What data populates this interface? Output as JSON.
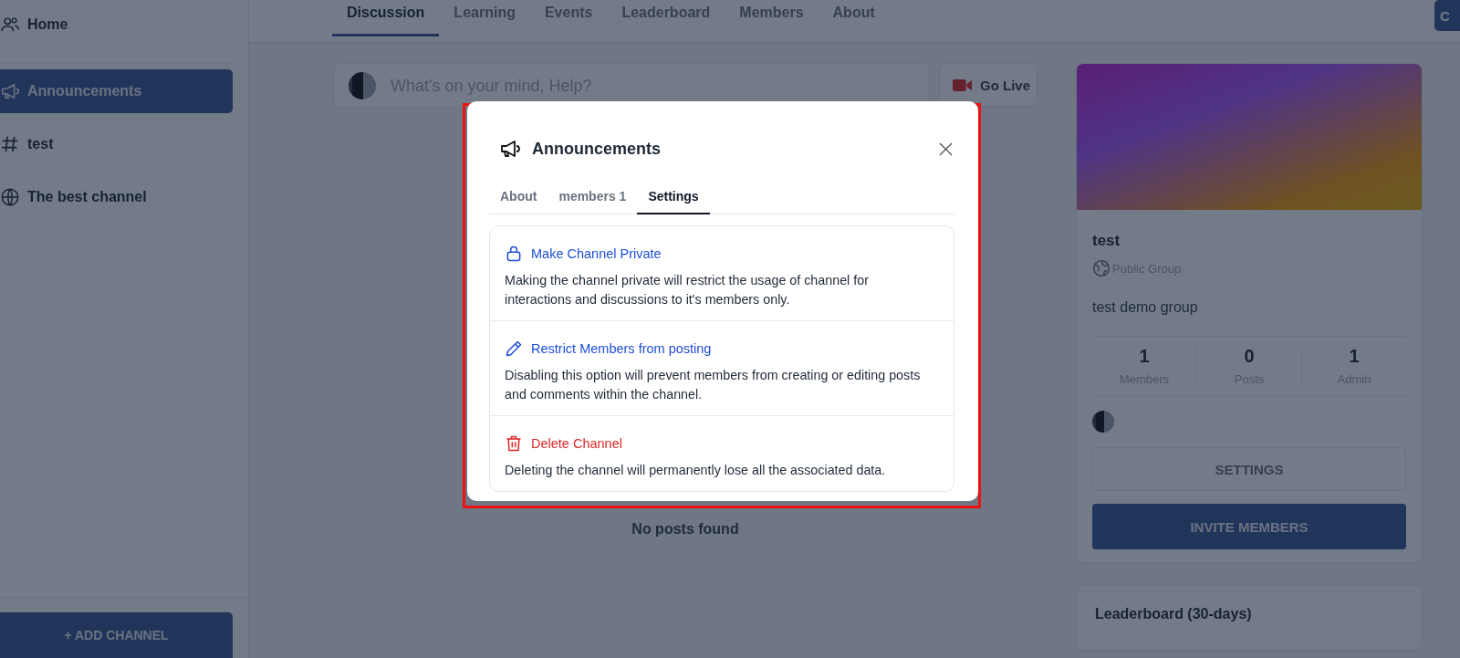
{
  "sidebar": {
    "home": {
      "label": "Home"
    },
    "channels": [
      {
        "label": "Announcements",
        "kind": "megaphone",
        "selected": true
      },
      {
        "label": "test",
        "kind": "hash",
        "selected": false
      },
      {
        "label": "The best channel",
        "kind": "globe",
        "selected": false
      }
    ],
    "add_button": "+ ADD CHANNEL"
  },
  "nav_tabs": [
    {
      "label": "Discussion",
      "selected": true
    },
    {
      "label": "Learning",
      "selected": false
    },
    {
      "label": "Events",
      "selected": false
    },
    {
      "label": "Leaderboard",
      "selected": false
    },
    {
      "label": "Members",
      "selected": false
    },
    {
      "label": "About",
      "selected": false
    }
  ],
  "header_button": "C",
  "composer": {
    "placeholder": "What's on your mind, Help?",
    "go_live": "Go Live"
  },
  "feed": {
    "empty_text": "No posts found"
  },
  "group_card": {
    "name": "test",
    "privacy": "Public Group",
    "description": "test demo group",
    "stats": [
      {
        "value": "1",
        "label": "Members"
      },
      {
        "value": "0",
        "label": "Posts"
      },
      {
        "value": "1",
        "label": "Admin"
      }
    ],
    "settings_button": "SETTINGS",
    "invite_button": "INVITE MEMBERS"
  },
  "leaderboard": {
    "title": "Leaderboard (30-days)"
  },
  "modal": {
    "title": "Announcements",
    "tabs": [
      {
        "label": "About",
        "selected": false
      },
      {
        "label": "members 1",
        "selected": false
      },
      {
        "label": "Settings",
        "selected": true
      }
    ],
    "options": [
      {
        "kind": "lock",
        "danger": false,
        "title": "Make Channel Private",
        "description": "Making the channel private will restrict the usage of channel for interactions and discussions to it's members only."
      },
      {
        "kind": "pencil",
        "danger": false,
        "title": "Restrict Members from posting",
        "description": "Disabling this option will prevent members from creating or editing posts and comments within the channel."
      },
      {
        "kind": "trash",
        "danger": true,
        "title": "Delete Channel",
        "description": "Deleting the channel will permanently lose all the associated data."
      }
    ]
  }
}
